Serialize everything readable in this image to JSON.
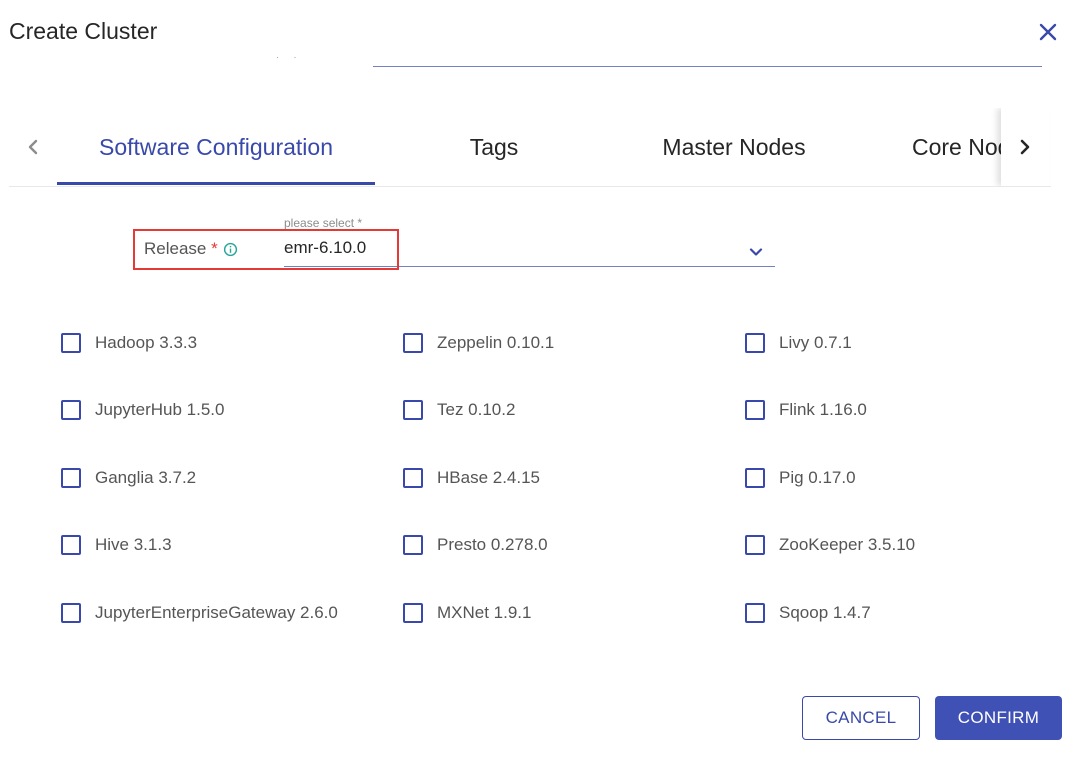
{
  "dialog": {
    "title": "Create Cluster"
  },
  "tabs": [
    {
      "label": "Software Configuration",
      "active": true
    },
    {
      "label": "Tags",
      "active": false
    },
    {
      "label": "Master Nodes",
      "active": false
    },
    {
      "label": "Core Nodes",
      "active": false
    }
  ],
  "release": {
    "label": "Release",
    "required_mark": "*",
    "hint": "please select *",
    "value": "emr-6.10.0"
  },
  "applications": [
    {
      "label": "Hadoop 3.3.3",
      "checked": false
    },
    {
      "label": "Zeppelin 0.10.1",
      "checked": false
    },
    {
      "label": "Livy 0.7.1",
      "checked": false
    },
    {
      "label": "JupyterHub 1.5.0",
      "checked": false
    },
    {
      "label": "Tez 0.10.2",
      "checked": false
    },
    {
      "label": "Flink 1.16.0",
      "checked": false
    },
    {
      "label": "Ganglia 3.7.2",
      "checked": false
    },
    {
      "label": "HBase 2.4.15",
      "checked": false
    },
    {
      "label": "Pig 0.17.0",
      "checked": false
    },
    {
      "label": "Hive 3.1.3",
      "checked": false
    },
    {
      "label": "Presto 0.278.0",
      "checked": false
    },
    {
      "label": "ZooKeeper 3.5.10",
      "checked": false
    },
    {
      "label": "JupyterEnterpriseGateway 2.6.0",
      "checked": false
    },
    {
      "label": "MXNet 1.9.1",
      "checked": false
    },
    {
      "label": "Sqoop 1.4.7",
      "checked": false
    }
  ],
  "actions": {
    "cancel_label": "CANCEL",
    "confirm_label": "CONFIRM"
  },
  "icons": {
    "close": "close-icon",
    "tab_prev": "chevron-left-icon",
    "tab_next": "chevron-right-icon",
    "info": "info-icon",
    "select": "chevron-down-icon"
  },
  "colors": {
    "primary": "#3949ab",
    "required": "#e53935",
    "info": "#26a69a"
  }
}
